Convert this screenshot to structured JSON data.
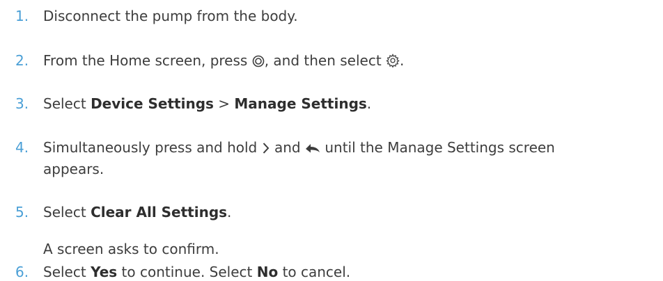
{
  "steps": [
    {
      "number": "1.",
      "text": "Disconnect the pump from the body."
    },
    {
      "number": "2.",
      "text_a": "From the Home screen, press",
      "icon_a": "menu-button-icon",
      "text_b": ", and then select",
      "icon_b": "settings-gear-icon",
      "text_c": "."
    },
    {
      "number": "3.",
      "text_a": "Select",
      "bold_a": "Device Settings",
      "text_b": ">",
      "bold_b": "Manage Settings",
      "text_c": "."
    },
    {
      "number": "4.",
      "text_a": "Simultaneously press and hold",
      "icon_a": "chevron-right-icon",
      "text_b": "and",
      "icon_b": "back-arrow-icon",
      "text_c": "until the Manage Settings screen",
      "text_d": "appears."
    },
    {
      "number": "5.",
      "text_a": "Select",
      "bold_a": "Clear All Settings",
      "text_b": ".",
      "note": "A screen asks to confirm."
    },
    {
      "number": "6.",
      "text_a": "Select",
      "bold_a": "Yes",
      "text_b": "to continue. Select",
      "bold_b": "No",
      "text_c": "to cancel."
    }
  ],
  "colors": {
    "number": "#4a9fd6",
    "text": "#3d3d3d"
  }
}
